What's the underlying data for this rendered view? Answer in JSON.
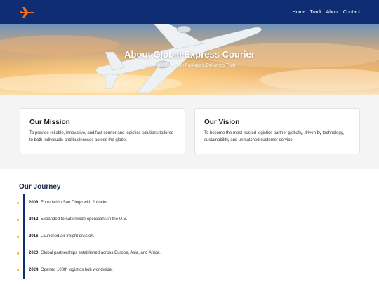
{
  "brand": {
    "logo_icon": "airplane-icon",
    "accent": "#f26b1d"
  },
  "nav": {
    "items": [
      "Home",
      "Track",
      "About",
      "Contact"
    ]
  },
  "hero": {
    "title": "About Global Express Courier",
    "subtitle": "Delivering More Than Packages: Delivering Trust"
  },
  "mission": {
    "title": "Our Mission",
    "text": "To provide reliable, innovative, and fast courier and logistics solutions tailored to both individuals and businesses across the globe."
  },
  "vision": {
    "title": "Our Vision",
    "text": "To become the most trusted logistics partner globally, driven by technology, sustainability, and unmatched customer service."
  },
  "journey": {
    "title": "Our Journey",
    "items": [
      {
        "year": "2008:",
        "text": " Founded in San Diego with 2 trucks."
      },
      {
        "year": "2012:",
        "text": " Expanded to nationwide operations in the U.S."
      },
      {
        "year": "2016:",
        "text": " Launched air freight division."
      },
      {
        "year": "2020:",
        "text": " Global partnerships established across Europe, Asia, and Africa."
      },
      {
        "year": "2024:",
        "text": " Opened 100th logistics hub worldwide."
      }
    ]
  },
  "colors": {
    "header_bg": "#0e2d73",
    "timeline_line": "#0e2d73",
    "timeline_dot": "#f0b400"
  }
}
